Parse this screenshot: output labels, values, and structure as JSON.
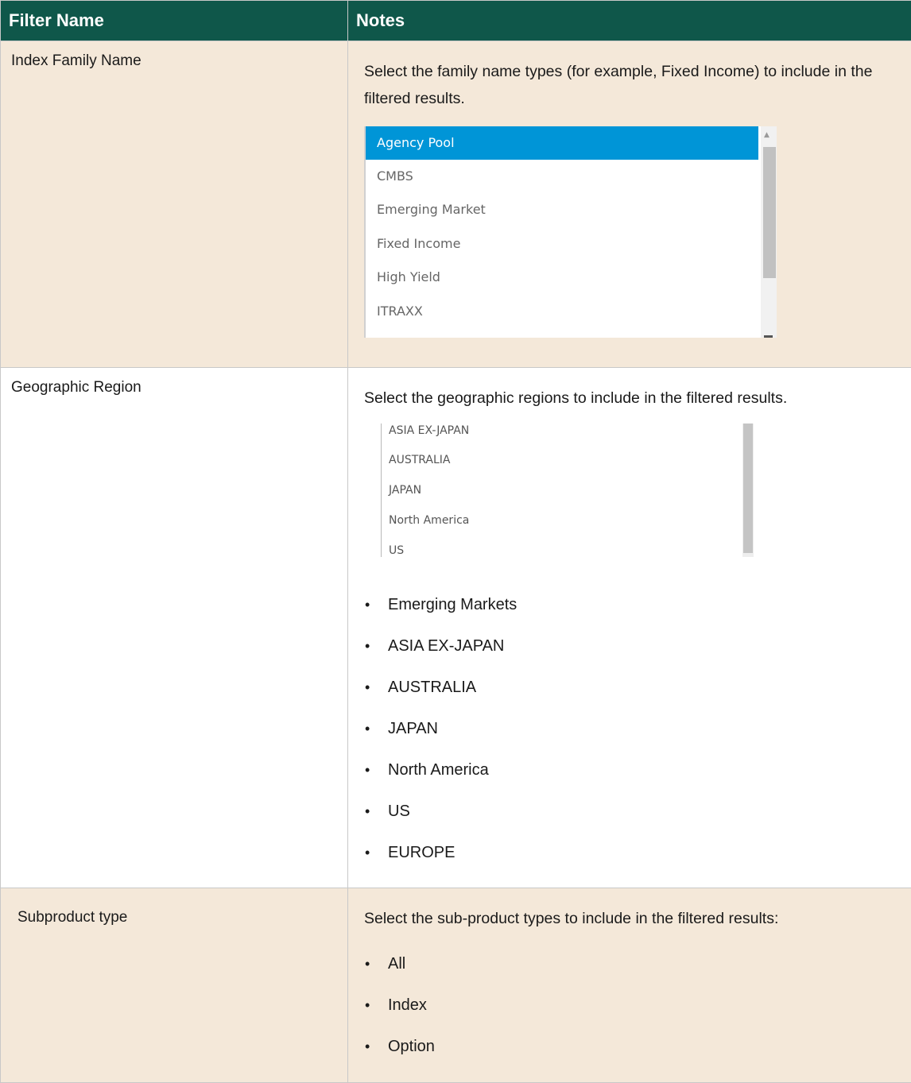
{
  "table": {
    "headers": [
      "Filter Name",
      "Notes"
    ],
    "rows": [
      {
        "name": "Index Family Name",
        "note": "Select the family name types (for example, Fixed Income) to include in the filtered results.",
        "listbox": {
          "items": [
            "Agency Pool",
            "CMBS",
            "Emerging Market",
            "Fixed Income",
            "High Yield",
            "ITRAXX"
          ],
          "selected": "Agency Pool"
        }
      },
      {
        "name": "Geographic Region",
        "note": "Select the geographic regions to include in the filtered results.",
        "listbox": {
          "items": [
            "ASIA EX-JAPAN",
            "AUSTRALIA",
            "JAPAN",
            "North America",
            "US"
          ]
        },
        "bullets": [
          "Emerging Markets",
          "ASIA EX-JAPAN",
          "AUSTRALIA",
          "JAPAN",
          "North America",
          "US",
          "EUROPE"
        ]
      },
      {
        "name": "Subproduct type",
        "note": "Select the sub-product types to include in the filtered results:",
        "bullets": [
          "All",
          "Index",
          "Option"
        ]
      }
    ]
  },
  "colors": {
    "header_bg": "#0f574a",
    "row_tan": "#f4e8d9",
    "selected_item": "#0095d7"
  }
}
